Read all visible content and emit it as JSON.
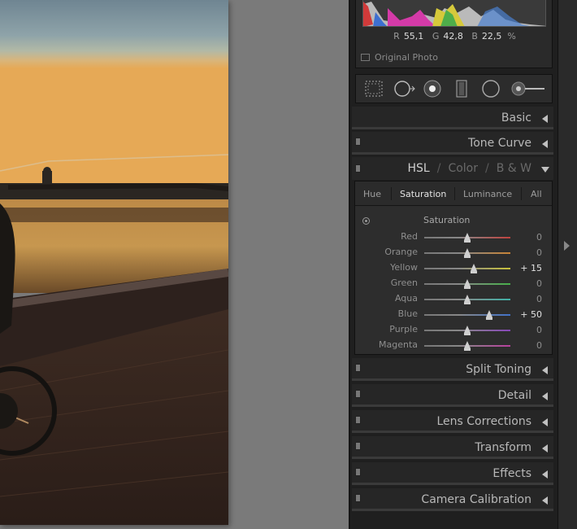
{
  "histogram": {
    "readout": [
      {
        "channel": "R",
        "value": "55,1"
      },
      {
        "channel": "G",
        "value": "42,8"
      },
      {
        "channel": "B",
        "value": "22,5"
      }
    ],
    "unit": "%",
    "original_photo_label": "Original Photo"
  },
  "toolbar": {
    "tools": [
      "crop-overlay-icon",
      "spot-removal-icon",
      "red-eye-correction-icon",
      "graduated-filter-icon",
      "radial-filter-icon",
      "adjustment-brush-icon"
    ]
  },
  "sections_top": {
    "basic": "Basic",
    "tone_curve": "Tone Curve"
  },
  "hsl": {
    "header": {
      "hsl": "HSL",
      "color": "Color",
      "bw": "B & W",
      "sep": "/"
    },
    "tabs": {
      "hue": "Hue",
      "saturation": "Saturation",
      "luminance": "Luminance",
      "all": "All"
    },
    "sub_title": "Saturation",
    "rows": [
      {
        "label": "Red",
        "value": "0",
        "level": 0,
        "color": "#c0433f"
      },
      {
        "label": "Orange",
        "value": "0",
        "level": 0,
        "color": "#c88436"
      },
      {
        "label": "Yellow",
        "value": "+ 15",
        "level": 15,
        "color": "#c9c23b"
      },
      {
        "label": "Green",
        "value": "0",
        "level": 0,
        "color": "#47b04a"
      },
      {
        "label": "Aqua",
        "value": "0",
        "level": 0,
        "color": "#3fb0a6"
      },
      {
        "label": "Blue",
        "value": "+ 50",
        "level": 50,
        "color": "#4272c8"
      },
      {
        "label": "Purple",
        "value": "0",
        "level": 0,
        "color": "#8747b8"
      },
      {
        "label": "Magenta",
        "value": "0",
        "level": 0,
        "color": "#b8409e"
      }
    ]
  },
  "sections_bottom": {
    "split_toning": "Split Toning",
    "detail": "Detail",
    "lens_corrections": "Lens Corrections",
    "transform": "Transform",
    "effects": "Effects",
    "camera_calibration": "Camera Calibration"
  }
}
